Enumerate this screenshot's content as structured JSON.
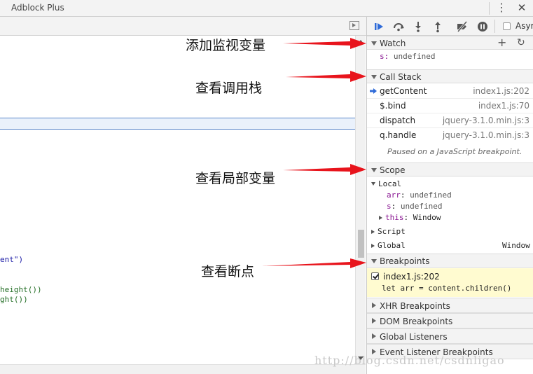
{
  "window": {
    "title": "Adblock Plus",
    "more_icon": "more-vert-icon",
    "close_icon": "close-icon"
  },
  "source": {
    "code_lines": [
      {
        "text": "ent\")",
        "color": "#1a1aa6"
      },
      {
        "text": "height())",
        "color": "#236e25"
      },
      {
        "text": "ght())",
        "color": "#236e25"
      }
    ]
  },
  "toolbar": {
    "buttons": [
      "resume-icon",
      "step-over-icon",
      "step-into-icon",
      "step-out-icon",
      "deactivate-breakpoints-icon",
      "pause-on-exceptions-icon"
    ],
    "async_label": "Asyr"
  },
  "watch": {
    "title": "Watch",
    "items": [
      {
        "name": "s",
        "value": "undefined"
      }
    ]
  },
  "call_stack": {
    "title": "Call Stack",
    "frames": [
      {
        "fn": "getContent",
        "loc": "index1.js:202",
        "current": true
      },
      {
        "fn": "$.bind",
        "loc": "index1.js:70",
        "current": false
      },
      {
        "fn": "dispatch",
        "loc": "jquery-3.1.0.min.js:3",
        "current": false
      },
      {
        "fn": "q.handle",
        "loc": "jquery-3.1.0.min.js:3",
        "current": false
      }
    ],
    "paused_message": "Paused on a JavaScript breakpoint."
  },
  "scope": {
    "title": "Scope",
    "local_label": "Local",
    "local_vars": [
      {
        "name": "arr",
        "value": "undefined"
      },
      {
        "name": "s",
        "value": "undefined"
      },
      {
        "name": "this",
        "value": "Window"
      }
    ],
    "script_label": "Script",
    "global_label": "Global",
    "global_value": "Window"
  },
  "breakpoints": {
    "title": "Breakpoints",
    "items": [
      {
        "loc": "index1.js:202",
        "code": "let arr = content.children()",
        "checked": true
      }
    ]
  },
  "collapsed_panes": [
    "XHR Breakpoints",
    "DOM Breakpoints",
    "Global Listeners",
    "Event Listener Breakpoints"
  ],
  "annotations": {
    "watch": "添加监视变量",
    "call_stack": "查看调用栈",
    "scope": "查看局部变量",
    "breakpoints": "查看断点",
    "arrow_color": "#e8141c"
  },
  "watermark": "http://blog.csdn.net/csdnligao"
}
